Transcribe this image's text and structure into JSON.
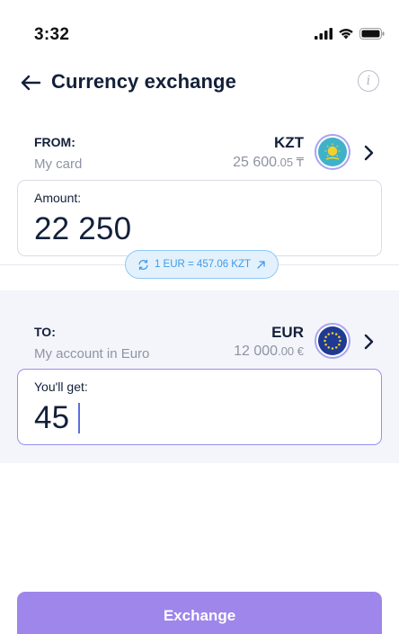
{
  "status_bar": {
    "time": "3:32"
  },
  "header": {
    "title": "Currency exchange"
  },
  "from": {
    "label": "FROM:",
    "account": "My card",
    "currency": "KZT",
    "balance_main": "25 600",
    "balance_frac": ".05 ₸",
    "flag": "kazakhstan-flag-icon",
    "amount_label": "Amount:",
    "amount": "22 250"
  },
  "rate": {
    "text": "1 EUR = 457.06 KZT"
  },
  "to": {
    "label": "TO:",
    "account": "My account in Euro",
    "currency": "EUR",
    "balance_main": "12 000",
    "balance_frac": ".00 €",
    "flag": "eu-flag-icon",
    "amount_label": "You'll get:",
    "amount": "45"
  },
  "action": {
    "label": "Exchange"
  },
  "colors": {
    "accent": "#9e86ea",
    "rate_pill": "#e3f1fd",
    "rate_text": "#3f9ae6",
    "to_background": "#f4f5fb"
  }
}
